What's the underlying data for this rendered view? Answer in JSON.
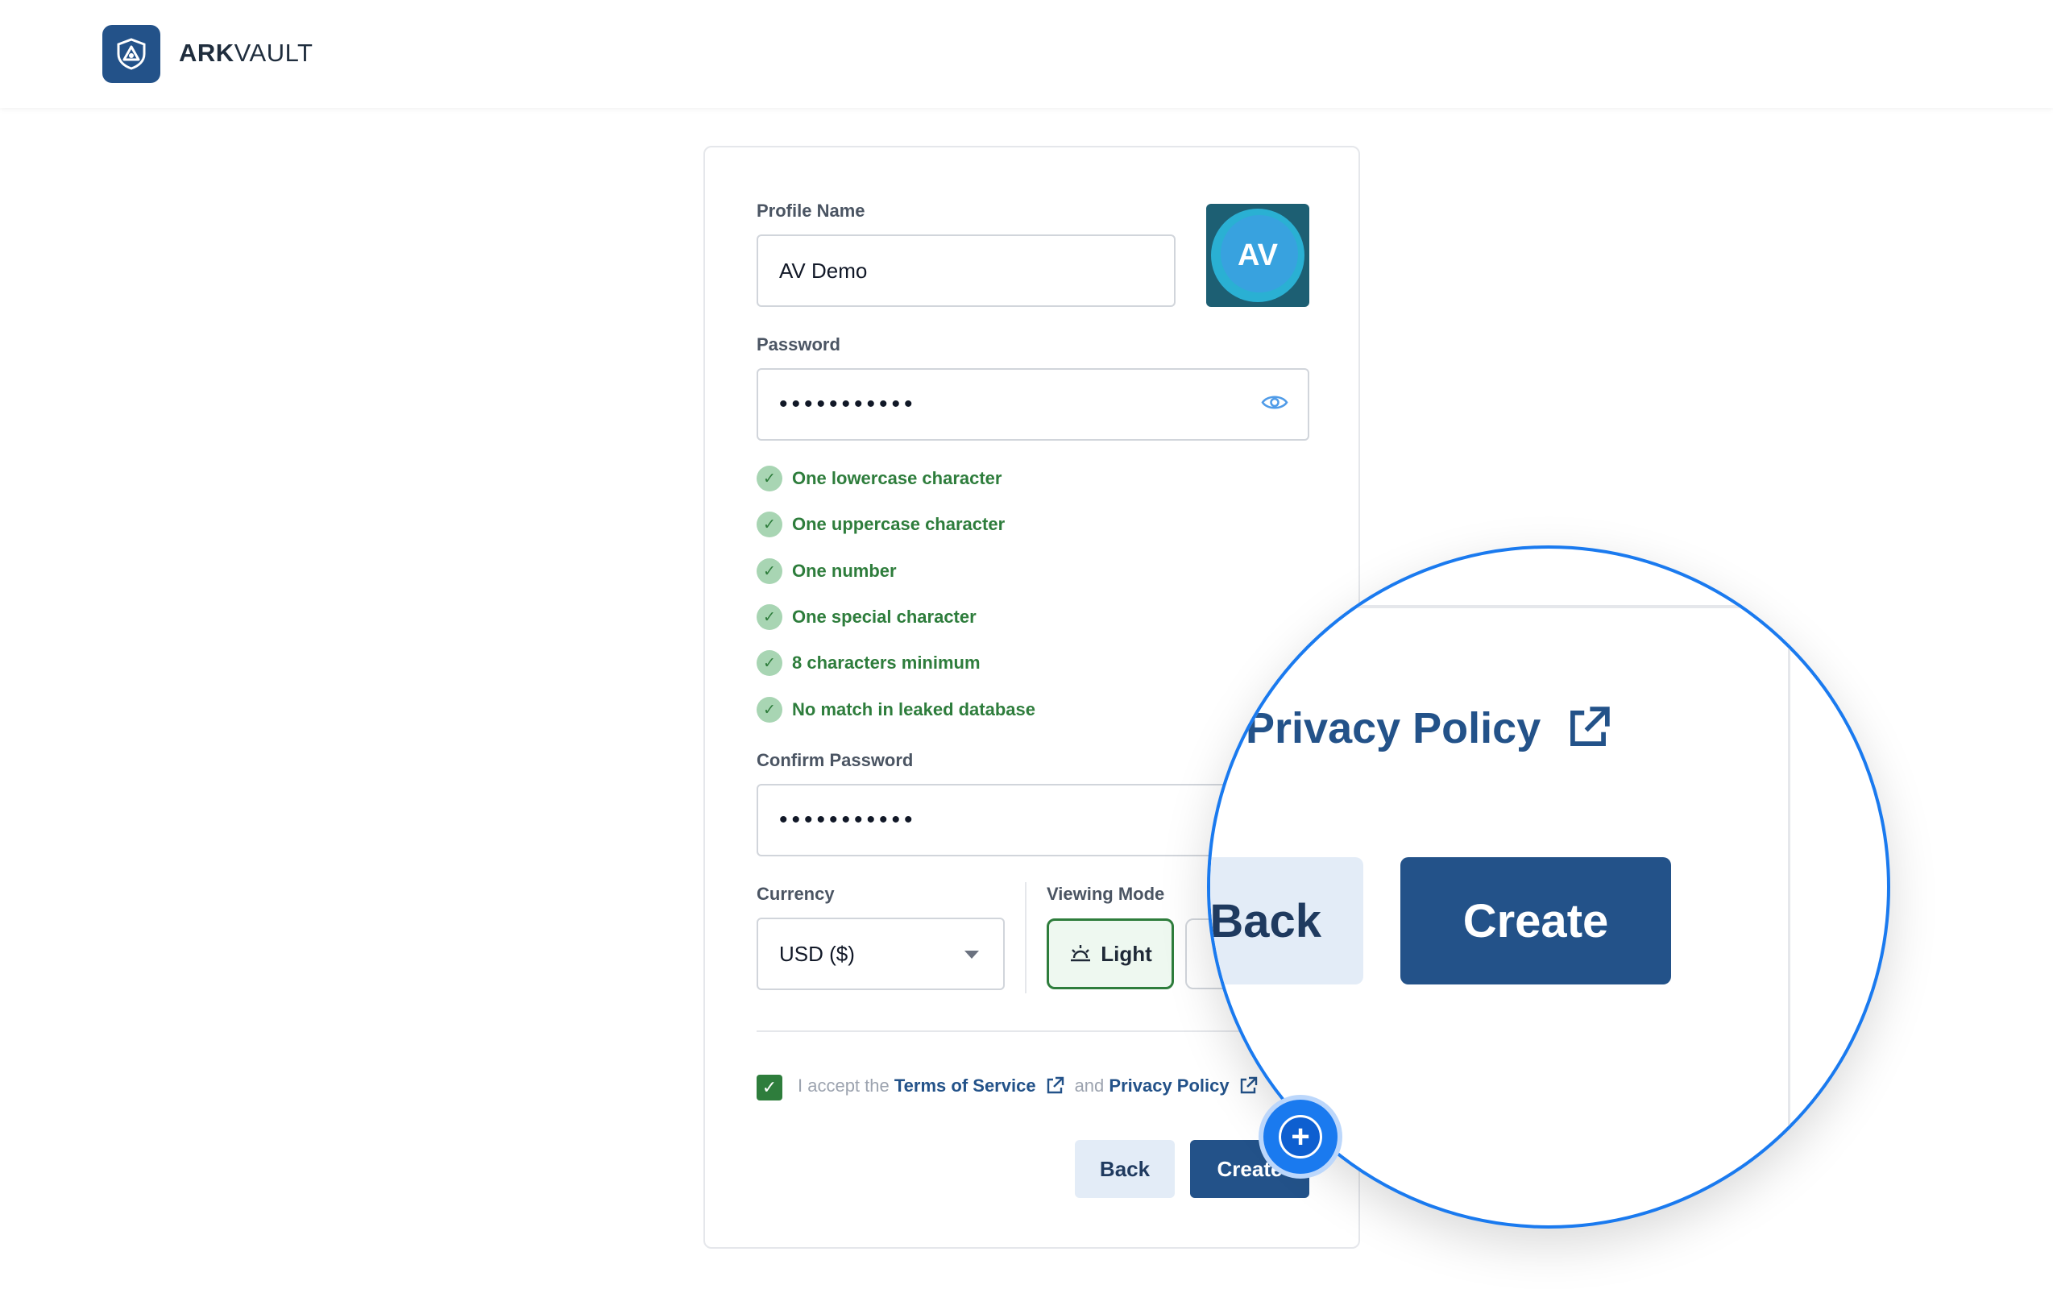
{
  "header": {
    "brand_bold": "ARK",
    "brand_light": "VAULT"
  },
  "form": {
    "profile_name_label": "Profile Name",
    "profile_name_value": "AV Demo",
    "avatar_initials": "AV",
    "password_label": "Password",
    "password_value": "•••••••••••",
    "rules": [
      "One lowercase character",
      "One uppercase character",
      "One number",
      "One special character",
      "8 characters minimum",
      "No match in leaked database"
    ],
    "confirm_label": "Confirm Password",
    "confirm_value": "•••••••••••",
    "currency_label": "Currency",
    "currency_value": "USD ($)",
    "viewing_mode_label": "Viewing Mode",
    "mode_light": "Light",
    "terms_prefix": "I accept the",
    "terms_link": "Terms of Service",
    "terms_and": "and",
    "privacy_link": "Privacy Policy",
    "back_label": "Back",
    "create_label": "Create"
  },
  "magnifier": {
    "privacy_link": "Privacy Policy",
    "back_label": "Back",
    "create_label": "Create"
  },
  "colors": {
    "primary": "#235289",
    "success": "#2e7d3c",
    "accent": "#1a7aef"
  }
}
